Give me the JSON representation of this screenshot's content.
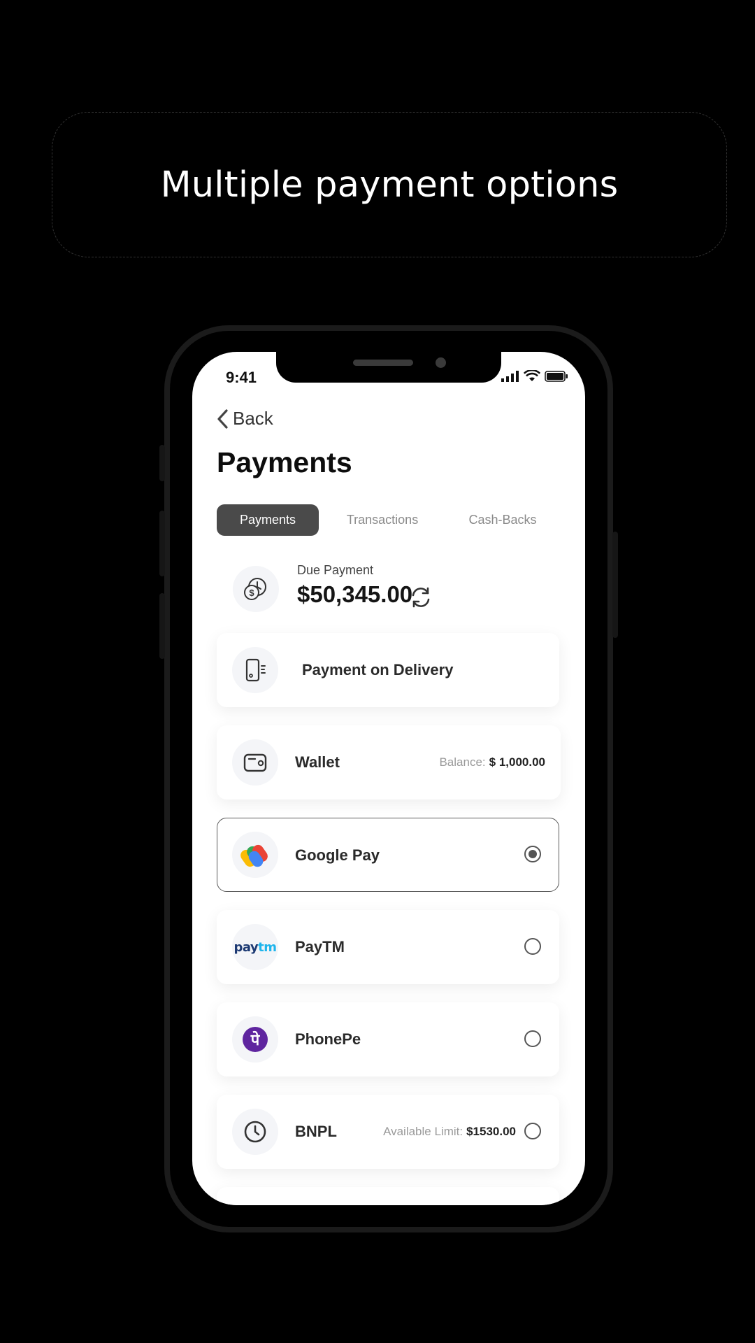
{
  "headline": "Multiple payment options",
  "status_bar": {
    "time": "9:41"
  },
  "nav": {
    "back_label": "Back"
  },
  "page": {
    "title": "Payments"
  },
  "tabs": [
    {
      "label": "Payments",
      "active": true
    },
    {
      "label": "Transactions",
      "active": false
    },
    {
      "label": "Cash-Backs",
      "active": false
    }
  ],
  "due": {
    "label": "Due Payment",
    "amount": "$50,345.00"
  },
  "options": {
    "delivery": {
      "label": "Payment on Delivery",
      "icon": "mobile-payment-icon"
    },
    "wallet": {
      "label": "Wallet",
      "extra_label": "Balance:",
      "extra_value": "$ 1,000.00",
      "icon": "wallet-icon"
    },
    "gpay": {
      "label": "Google Pay",
      "selected": true,
      "icon": "google-pay-icon"
    },
    "paytm": {
      "label": "PayTM",
      "logo_a": "pay",
      "logo_b": "tm",
      "selected": false,
      "icon": "paytm-icon"
    },
    "phonepe": {
      "label": "PhonePe",
      "logo": "पे",
      "selected": false,
      "icon": "phonepe-icon"
    },
    "bnpl": {
      "label": "BNPL",
      "extra_label": "Available Limit:",
      "extra_value": "$1530.00",
      "selected": false,
      "icon": "clock-icon"
    }
  },
  "colors": {
    "background": "#000000",
    "active_tab": "#4a4a4a",
    "paytm_dark": "#1d3a73",
    "paytm_light": "#1fb5ec",
    "phonepe": "#5f259f"
  }
}
